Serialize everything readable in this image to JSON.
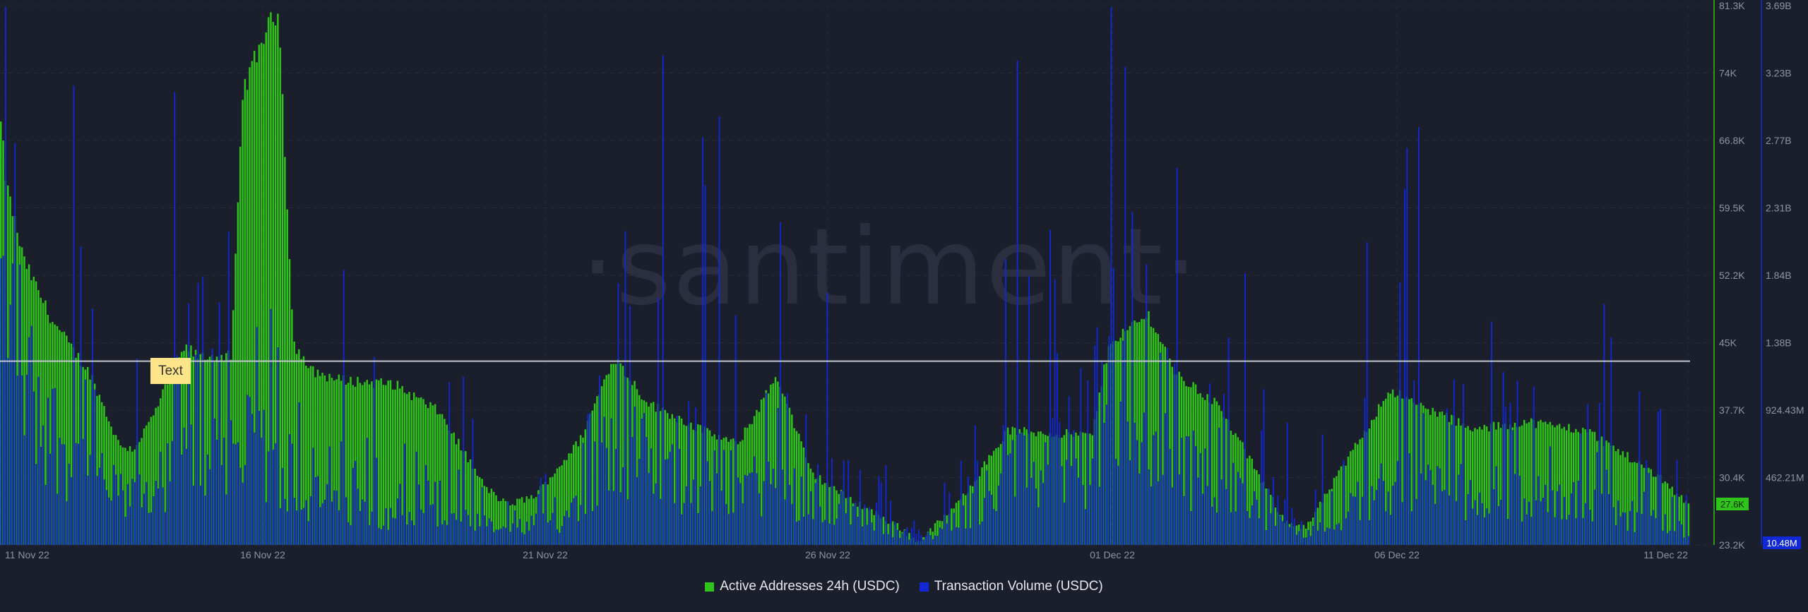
{
  "watermark": "·santiment·",
  "annotation": "Text",
  "chart_data": {
    "type": "bar",
    "x_ticks": [
      "11 Nov 22",
      "16 Nov 22",
      "21 Nov 22",
      "26 Nov 22",
      "01 Dec 22",
      "06 Dec 22",
      "11 Dec 22"
    ],
    "y_right_green_ticks": [
      "81.3K",
      "74K",
      "66.8K",
      "59.5K",
      "52.2K",
      "45K",
      "37.7K",
      "30.4K",
      "23.2K"
    ],
    "y_right_blue_ticks": [
      "3.69B",
      "3.23B",
      "2.77B",
      "2.31B",
      "1.84B",
      "1.38B",
      "924.43M",
      "462.21M"
    ],
    "ylim_active_addresses": [
      23200,
      81300
    ],
    "ylim_volume": [
      0,
      3690000000
    ],
    "horizontal_line_value": 43000,
    "current_badges": {
      "active_addresses": "27.6K",
      "volume": "10.48M"
    },
    "colors": {
      "active_addresses": "#2fc41a",
      "volume": "#1128d6"
    },
    "series": [
      {
        "name": "Active Addresses 24h (USDC)",
        "keypoints": [
          [
            0,
            68500
          ],
          [
            0.05,
            62000
          ],
          [
            0.2,
            54000
          ],
          [
            0.45,
            47500
          ],
          [
            0.8,
            41500
          ],
          [
            1.05,
            34000
          ],
          [
            1.18,
            33500
          ],
          [
            1.35,
            37000
          ],
          [
            1.55,
            42500
          ],
          [
            1.65,
            44500
          ],
          [
            1.75,
            43500
          ],
          [
            2.05,
            43500
          ],
          [
            2.15,
            72000
          ],
          [
            2.35,
            78500
          ],
          [
            2.47,
            80800
          ],
          [
            2.6,
            45000
          ],
          [
            2.75,
            42000
          ],
          [
            3.0,
            41000
          ],
          [
            3.5,
            40500
          ],
          [
            3.9,
            37500
          ],
          [
            4.3,
            29500
          ],
          [
            4.5,
            27500
          ],
          [
            4.75,
            28500
          ],
          [
            5.15,
            34500
          ],
          [
            5.45,
            43500
          ],
          [
            5.75,
            38500
          ],
          [
            6.25,
            35500
          ],
          [
            6.55,
            34000
          ],
          [
            6.9,
            41500
          ],
          [
            7.2,
            31000
          ],
          [
            7.5,
            28500
          ],
          [
            8.0,
            25000
          ],
          [
            8.15,
            23500
          ],
          [
            8.5,
            27500
          ],
          [
            8.95,
            35500
          ],
          [
            9.7,
            35000
          ],
          [
            9.85,
            45000
          ],
          [
            10.2,
            48000
          ],
          [
            10.45,
            41500
          ],
          [
            10.8,
            38500
          ],
          [
            11.05,
            33500
          ],
          [
            11.4,
            26000
          ],
          [
            11.6,
            25000
          ],
          [
            12.35,
            40000
          ],
          [
            12.55,
            38500
          ],
          [
            12.95,
            36500
          ],
          [
            13.05,
            35500
          ],
          [
            13.55,
            36500
          ],
          [
            14.1,
            35500
          ],
          [
            14.55,
            32000
          ],
          [
            14.75,
            30500
          ],
          [
            15.0,
            27500
          ]
        ]
      },
      {
        "name": "Transaction Volume (USDC)",
        "keypoints": [
          [
            0,
            1900000000
          ],
          [
            0.3,
            1100000000
          ],
          [
            0.6,
            700000000
          ],
          [
            1.0,
            400000000
          ],
          [
            1.2,
            330000000
          ],
          [
            1.6,
            600000000
          ],
          [
            2.05,
            800000000
          ],
          [
            2.3,
            700000000
          ],
          [
            2.6,
            400000000
          ],
          [
            3.0,
            300000000
          ],
          [
            4.0,
            200000000
          ],
          [
            4.5,
            110000000
          ],
          [
            5.0,
            200000000
          ],
          [
            5.45,
            800000000
          ],
          [
            6.0,
            500000000
          ],
          [
            6.9,
            450000000
          ],
          [
            7.5,
            260000000
          ],
          [
            8.0,
            100000000
          ],
          [
            8.3,
            60000000
          ],
          [
            8.6,
            260000000
          ],
          [
            9.0,
            560000000
          ],
          [
            9.7,
            450000000
          ],
          [
            9.85,
            850000000
          ],
          [
            10.2,
            700000000
          ],
          [
            10.8,
            500000000
          ],
          [
            11.4,
            150000000
          ],
          [
            11.7,
            100000000
          ],
          [
            12.35,
            500000000
          ],
          [
            13.0,
            400000000
          ],
          [
            14.0,
            350000000
          ],
          [
            14.6,
            200000000
          ],
          [
            15.0,
            100000000
          ]
        ]
      }
    ]
  }
}
